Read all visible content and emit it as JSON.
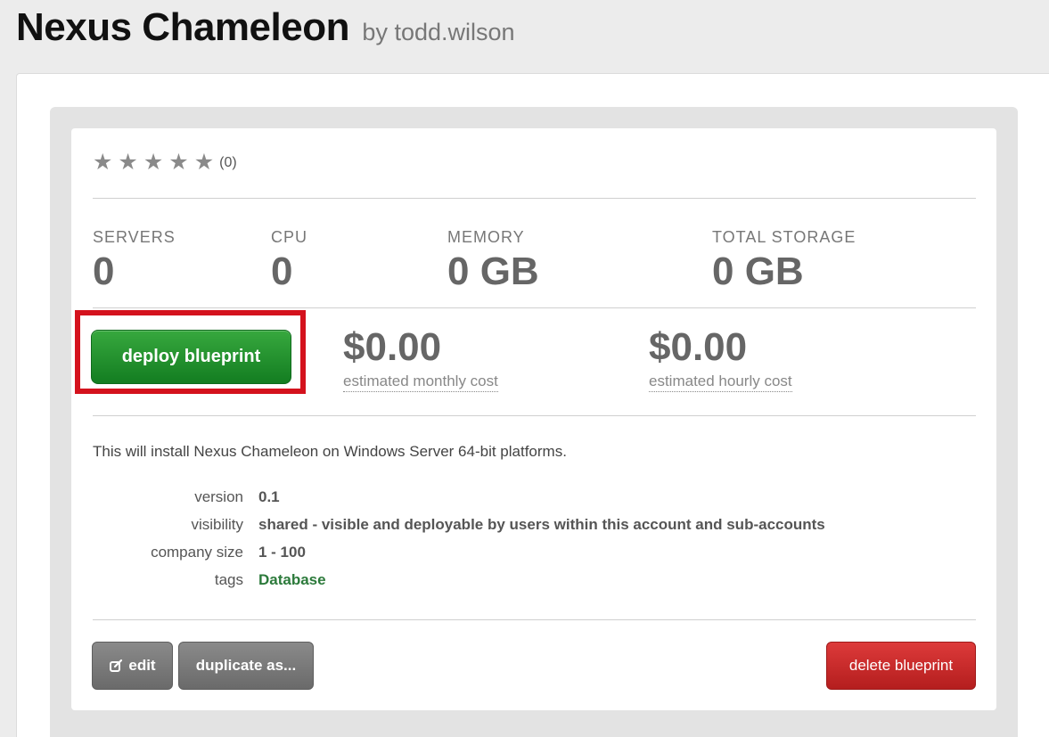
{
  "header": {
    "title": "Nexus Chameleon",
    "author": "by todd.wilson"
  },
  "rating": {
    "stars": 5,
    "filled": 0,
    "count_text": "(0)"
  },
  "stats": [
    {
      "label": "SERVERS",
      "value": "0"
    },
    {
      "label": "CPU",
      "value": "0"
    },
    {
      "label": "MEMORY",
      "value": "0 GB"
    },
    {
      "label": "TOTAL STORAGE",
      "value": "0 GB"
    }
  ],
  "deploy": {
    "label": "deploy blueprint"
  },
  "costs": {
    "monthly": {
      "amount": "$0.00",
      "label": "estimated monthly cost"
    },
    "hourly": {
      "amount": "$0.00",
      "label": "estimated hourly cost"
    }
  },
  "description": "This will install Nexus Chameleon on Windows Server 64-bit platforms.",
  "details": [
    {
      "key": "version",
      "value": "0.1"
    },
    {
      "key": "visibility",
      "value": "shared - visible and deployable by users within this account and sub-accounts"
    },
    {
      "key": "company size",
      "value": "1 - 100"
    },
    {
      "key": "tags",
      "value": "Database"
    }
  ],
  "actions": {
    "edit": "edit",
    "duplicate": "duplicate as...",
    "delete": "delete blueprint"
  },
  "colors": {
    "deploy_green": "#137d21",
    "highlight_red": "#d4121d",
    "delete_red": "#b41e1e",
    "tag_green": "#2c7a3b"
  },
  "icons": {
    "rating": "star-icon",
    "edit": "edit-icon"
  }
}
